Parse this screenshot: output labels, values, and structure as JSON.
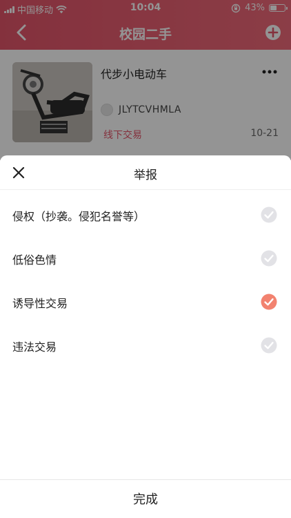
{
  "status_bar": {
    "carrier": "中国移动",
    "time": "10:04",
    "battery": "43%",
    "battery_level": 0.43
  },
  "nav": {
    "title": "校园二手"
  },
  "listing": {
    "title": "代步小电动车",
    "seller": "JLYTCVHMLA",
    "trade_type": "线下交易",
    "date": "10-21"
  },
  "report_sheet": {
    "title": "举报",
    "options": [
      {
        "label": "侵权（抄袭。侵犯名誉等）",
        "selected": false
      },
      {
        "label": "低俗色情",
        "selected": false
      },
      {
        "label": "诱导性交易",
        "selected": true
      },
      {
        "label": "违法交易",
        "selected": false
      }
    ],
    "done_label": "完成"
  },
  "colors": {
    "accent": "#e4556a",
    "selected_check": "#f2826f",
    "unselected_check": "#e2e2e6"
  }
}
